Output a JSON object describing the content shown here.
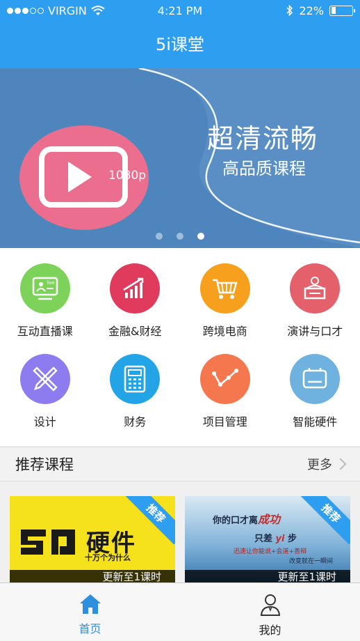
{
  "status": {
    "carrier": "VIRGIN",
    "time": "4:21 PM",
    "battery": "22%",
    "battery_level": 0.22
  },
  "nav": {
    "title": "5i课堂"
  },
  "banner": {
    "resolution": "1080p",
    "title": "超清流畅",
    "subtitle": "高品质课程",
    "pages": 3,
    "active_page": 3
  },
  "categories": [
    {
      "label": "互动直播课",
      "color": "#7dd35a",
      "icon": "live-class-icon"
    },
    {
      "label": "金融&财经",
      "color": "#e03a5d",
      "icon": "finance-chart-icon"
    },
    {
      "label": "跨境电商",
      "color": "#f6a01e",
      "icon": "shopping-cart-icon"
    },
    {
      "label": "演讲与口才",
      "color": "#e4606a",
      "icon": "podium-icon"
    },
    {
      "label": "设计",
      "color": "#8c7cf0",
      "icon": "design-tools-icon"
    },
    {
      "label": "财务",
      "color": "#22a4e6",
      "icon": "calculator-icon"
    },
    {
      "label": "项目管理",
      "color": "#f5774e",
      "icon": "line-graph-icon"
    },
    {
      "label": "智能硬件",
      "color": "#6fb2e0",
      "icon": "device-icon"
    }
  ],
  "recommend": {
    "title": "推荐课程",
    "more": "更多"
  },
  "courses": [
    {
      "badge": "推荐",
      "update": "更新至1课时",
      "headline": "硬件",
      "tagline": "十万个为什么"
    },
    {
      "badge": "推荐",
      "update": "更新至1课时",
      "line1": "你的口才离",
      "accent": "成功",
      "line2": "只差",
      "line2b": "yi",
      "line2c": "步",
      "line3": "迅速让你能说+会道+善辩",
      "line4": "改变就在一瞬间"
    }
  ],
  "tabs": [
    {
      "label": "首页",
      "icon": "home-icon",
      "active": true
    },
    {
      "label": "我的",
      "icon": "profile-icon",
      "active": false
    }
  ],
  "colors": {
    "primary": "#2e9ff0",
    "banner": "#5a8fc6",
    "tab_active": "#2e8fe0"
  }
}
